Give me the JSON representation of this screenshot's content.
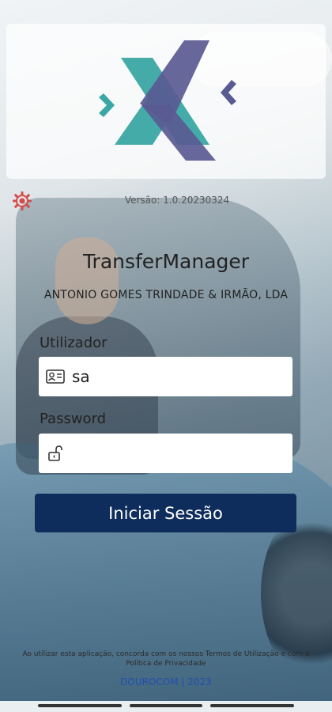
{
  "logo": {
    "icon": "transfermanager-x-logo",
    "colors": {
      "teal": "#3aa6a4",
      "purple": "#5a5a93"
    }
  },
  "settings": {
    "icon": "gear-icon",
    "color": "#d64a4a"
  },
  "version_text": "Versão: 1.0.20230324",
  "app_title": "TransferManager",
  "company": "ANTONIO GOMES TRINDADE & IRMÃO, LDA",
  "form": {
    "user_label": "Utilizador",
    "user_value": "sa",
    "user_icon": "id-card-icon",
    "password_label": "Password",
    "password_value": "",
    "password_icon": "unlock-icon",
    "submit_label": "Iniciar Sessão"
  },
  "terms_text": "Ao utilizar esta aplicação, concorda com os nossos Termos de Utilização e com a Política de Privacidade",
  "footer_text": "DOUROCOM | 2023",
  "colors": {
    "button": "#0f2d5c",
    "footer_link": "#1f4fb0"
  }
}
